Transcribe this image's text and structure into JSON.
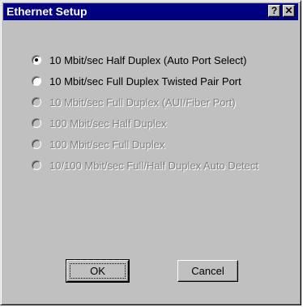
{
  "dialog": {
    "title": "Ethernet Setup",
    "help_label": "?",
    "close_label": "✕"
  },
  "options": [
    {
      "label": "10 Mbit/sec Half Duplex (Auto Port Select)",
      "selected": true,
      "enabled": true
    },
    {
      "label": "10 Mbit/sec Full Duplex Twisted Pair Port",
      "selected": false,
      "enabled": true
    },
    {
      "label": "10 Mbit/sec Full Duplex (AUI/Fiber Port)",
      "selected": false,
      "enabled": false
    },
    {
      "label": "100 Mbit/sec Half Duplex",
      "selected": false,
      "enabled": false
    },
    {
      "label": "100 Mbit/sec Full Duplex",
      "selected": false,
      "enabled": false
    },
    {
      "label": "10/100 Mbit/sec Full/Half Duplex Auto Detect",
      "selected": false,
      "enabled": false
    }
  ],
  "buttons": {
    "ok_label": "OK",
    "cancel_label": "Cancel"
  },
  "colors": {
    "titlebar": "#000080",
    "face": "#c0c0c0",
    "disabled_text": "#808080"
  }
}
